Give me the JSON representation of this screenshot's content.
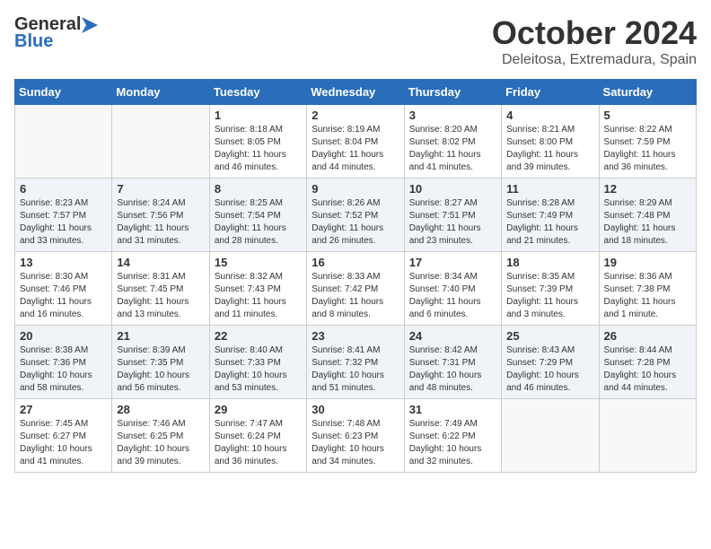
{
  "header": {
    "logo_general": "General",
    "logo_blue": "Blue",
    "month_title": "October 2024",
    "location": "Deleitosa, Extremadura, Spain"
  },
  "calendar": {
    "days_of_week": [
      "Sunday",
      "Monday",
      "Tuesday",
      "Wednesday",
      "Thursday",
      "Friday",
      "Saturday"
    ],
    "weeks": [
      [
        {
          "day": "",
          "content": ""
        },
        {
          "day": "",
          "content": ""
        },
        {
          "day": "1",
          "content": "Sunrise: 8:18 AM\nSunset: 8:05 PM\nDaylight: 11 hours and 46 minutes."
        },
        {
          "day": "2",
          "content": "Sunrise: 8:19 AM\nSunset: 8:04 PM\nDaylight: 11 hours and 44 minutes."
        },
        {
          "day": "3",
          "content": "Sunrise: 8:20 AM\nSunset: 8:02 PM\nDaylight: 11 hours and 41 minutes."
        },
        {
          "day": "4",
          "content": "Sunrise: 8:21 AM\nSunset: 8:00 PM\nDaylight: 11 hours and 39 minutes."
        },
        {
          "day": "5",
          "content": "Sunrise: 8:22 AM\nSunset: 7:59 PM\nDaylight: 11 hours and 36 minutes."
        }
      ],
      [
        {
          "day": "6",
          "content": "Sunrise: 8:23 AM\nSunset: 7:57 PM\nDaylight: 11 hours and 33 minutes."
        },
        {
          "day": "7",
          "content": "Sunrise: 8:24 AM\nSunset: 7:56 PM\nDaylight: 11 hours and 31 minutes."
        },
        {
          "day": "8",
          "content": "Sunrise: 8:25 AM\nSunset: 7:54 PM\nDaylight: 11 hours and 28 minutes."
        },
        {
          "day": "9",
          "content": "Sunrise: 8:26 AM\nSunset: 7:52 PM\nDaylight: 11 hours and 26 minutes."
        },
        {
          "day": "10",
          "content": "Sunrise: 8:27 AM\nSunset: 7:51 PM\nDaylight: 11 hours and 23 minutes."
        },
        {
          "day": "11",
          "content": "Sunrise: 8:28 AM\nSunset: 7:49 PM\nDaylight: 11 hours and 21 minutes."
        },
        {
          "day": "12",
          "content": "Sunrise: 8:29 AM\nSunset: 7:48 PM\nDaylight: 11 hours and 18 minutes."
        }
      ],
      [
        {
          "day": "13",
          "content": "Sunrise: 8:30 AM\nSunset: 7:46 PM\nDaylight: 11 hours and 16 minutes."
        },
        {
          "day": "14",
          "content": "Sunrise: 8:31 AM\nSunset: 7:45 PM\nDaylight: 11 hours and 13 minutes."
        },
        {
          "day": "15",
          "content": "Sunrise: 8:32 AM\nSunset: 7:43 PM\nDaylight: 11 hours and 11 minutes."
        },
        {
          "day": "16",
          "content": "Sunrise: 8:33 AM\nSunset: 7:42 PM\nDaylight: 11 hours and 8 minutes."
        },
        {
          "day": "17",
          "content": "Sunrise: 8:34 AM\nSunset: 7:40 PM\nDaylight: 11 hours and 6 minutes."
        },
        {
          "day": "18",
          "content": "Sunrise: 8:35 AM\nSunset: 7:39 PM\nDaylight: 11 hours and 3 minutes."
        },
        {
          "day": "19",
          "content": "Sunrise: 8:36 AM\nSunset: 7:38 PM\nDaylight: 11 hours and 1 minute."
        }
      ],
      [
        {
          "day": "20",
          "content": "Sunrise: 8:38 AM\nSunset: 7:36 PM\nDaylight: 10 hours and 58 minutes."
        },
        {
          "day": "21",
          "content": "Sunrise: 8:39 AM\nSunset: 7:35 PM\nDaylight: 10 hours and 56 minutes."
        },
        {
          "day": "22",
          "content": "Sunrise: 8:40 AM\nSunset: 7:33 PM\nDaylight: 10 hours and 53 minutes."
        },
        {
          "day": "23",
          "content": "Sunrise: 8:41 AM\nSunset: 7:32 PM\nDaylight: 10 hours and 51 minutes."
        },
        {
          "day": "24",
          "content": "Sunrise: 8:42 AM\nSunset: 7:31 PM\nDaylight: 10 hours and 48 minutes."
        },
        {
          "day": "25",
          "content": "Sunrise: 8:43 AM\nSunset: 7:29 PM\nDaylight: 10 hours and 46 minutes."
        },
        {
          "day": "26",
          "content": "Sunrise: 8:44 AM\nSunset: 7:28 PM\nDaylight: 10 hours and 44 minutes."
        }
      ],
      [
        {
          "day": "27",
          "content": "Sunrise: 7:45 AM\nSunset: 6:27 PM\nDaylight: 10 hours and 41 minutes."
        },
        {
          "day": "28",
          "content": "Sunrise: 7:46 AM\nSunset: 6:25 PM\nDaylight: 10 hours and 39 minutes."
        },
        {
          "day": "29",
          "content": "Sunrise: 7:47 AM\nSunset: 6:24 PM\nDaylight: 10 hours and 36 minutes."
        },
        {
          "day": "30",
          "content": "Sunrise: 7:48 AM\nSunset: 6:23 PM\nDaylight: 10 hours and 34 minutes."
        },
        {
          "day": "31",
          "content": "Sunrise: 7:49 AM\nSunset: 6:22 PM\nDaylight: 10 hours and 32 minutes."
        },
        {
          "day": "",
          "content": ""
        },
        {
          "day": "",
          "content": ""
        }
      ]
    ]
  }
}
